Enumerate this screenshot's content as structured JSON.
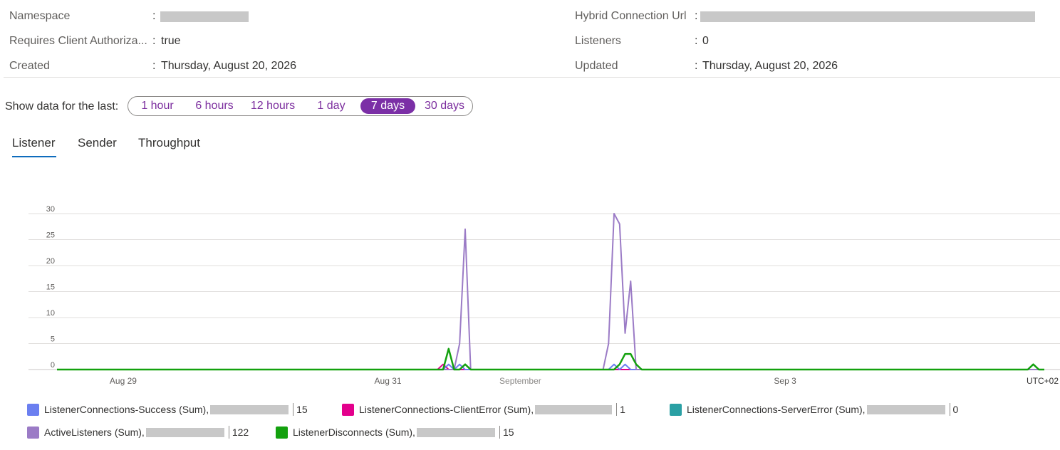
{
  "properties": {
    "left": [
      {
        "label": "Namespace",
        "value": ""
      },
      {
        "label": "Requires Client Authoriza...",
        "value": "true"
      },
      {
        "label": "Created",
        "value": "Thursday, August 20, 2026"
      }
    ],
    "right": [
      {
        "label": "Hybrid Connection Url",
        "value": ""
      },
      {
        "label": "Listeners",
        "value": "0"
      },
      {
        "label": "Updated",
        "value": "Thursday, August 20, 2026"
      }
    ],
    "colon": ":"
  },
  "range": {
    "label": "Show data for the last:",
    "options": [
      "1 hour",
      "6 hours",
      "12 hours",
      "1 day",
      "7 days",
      "30 days"
    ],
    "selected": "7 days"
  },
  "tabs": [
    {
      "label": "Listener",
      "active": true
    },
    {
      "label": "Sender",
      "active": false
    },
    {
      "label": "Throughput",
      "active": false
    }
  ],
  "chart_data": {
    "type": "line",
    "x_ticks": [
      "Aug 29",
      "Aug 31",
      "September",
      "Sep 3"
    ],
    "timezone_label": "UTC+02",
    "ylim": [
      0,
      30
    ],
    "y_ticks": [
      0,
      5,
      10,
      15,
      20,
      25,
      30
    ],
    "grid": true,
    "x_start": "Aug 28 12:00",
    "x_end": "Sep 4 23:00",
    "series": [
      {
        "name": "ListenerConnections-Success (Sum),",
        "color": "#6b7ff0",
        "total": "15",
        "points": [
          [
            "Aug 28 12:00",
            0
          ],
          [
            "Aug 31 10:00",
            0
          ],
          [
            "Aug 31 11:00",
            1
          ],
          [
            "Aug 31 12:00",
            0
          ],
          [
            "Aug 31 13:00",
            1
          ],
          [
            "Aug 31 14:00",
            0
          ],
          [
            "Sep 1 16:00",
            0
          ],
          [
            "Sep 1 17:00",
            1
          ],
          [
            "Sep 1 18:00",
            0
          ],
          [
            "Sep 1 19:00",
            1
          ],
          [
            "Sep 1 20:00",
            0
          ],
          [
            "Sep 4 23:00",
            0
          ]
        ]
      },
      {
        "name": "ListenerConnections-ClientError (Sum),",
        "color": "#e3008c",
        "total": "1",
        "points": [
          [
            "Aug 28 12:00",
            0
          ],
          [
            "Aug 31 9:00",
            0
          ],
          [
            "Aug 31 10:00",
            1
          ],
          [
            "Aug 31 11:00",
            0
          ],
          [
            "Sep 4 23:00",
            0
          ]
        ]
      },
      {
        "name": "ListenerConnections-ServerError (Sum),",
        "color": "#2aa0a4",
        "total": "0",
        "points": [
          [
            "Aug 28 12:00",
            0
          ],
          [
            "Sep 4 23:00",
            0
          ]
        ]
      },
      {
        "name": "ActiveListeners (Sum),",
        "color": "#9b7bc6",
        "total": "122",
        "points": [
          [
            "Aug 28 12:00",
            0
          ],
          [
            "Aug 31 11:00",
            0
          ],
          [
            "Aug 31 12:00",
            0
          ],
          [
            "Aug 31 13:00",
            5
          ],
          [
            "Aug 31 14:00",
            27
          ],
          [
            "Aug 31 15:00",
            0
          ],
          [
            "Sep 1 15:00",
            0
          ],
          [
            "Sep 1 16:00",
            5
          ],
          [
            "Sep 1 17:00",
            30
          ],
          [
            "Sep 1 18:00",
            28
          ],
          [
            "Sep 1 19:00",
            7
          ],
          [
            "Sep 1 20:00",
            17
          ],
          [
            "Sep 1 21:00",
            0
          ],
          [
            "Sep 4 23:00",
            0
          ]
        ]
      },
      {
        "name": "ListenerDisconnects (Sum),",
        "color": "#13a10e",
        "total": "15",
        "points": [
          [
            "Aug 28 12:00",
            0
          ],
          [
            "Aug 31 10:00",
            0
          ],
          [
            "Aug 31 11:00",
            4
          ],
          [
            "Aug 31 12:00",
            0
          ],
          [
            "Aug 31 13:00",
            0
          ],
          [
            "Aug 31 14:00",
            1
          ],
          [
            "Aug 31 15:00",
            0
          ],
          [
            "Sep 1 17:00",
            0
          ],
          [
            "Sep 1 18:00",
            1
          ],
          [
            "Sep 1 19:00",
            3
          ],
          [
            "Sep 1 20:00",
            3
          ],
          [
            "Sep 1 21:00",
            1
          ],
          [
            "Sep 1 22:00",
            0
          ],
          [
            "Sep 4 20:00",
            0
          ],
          [
            "Sep 4 21:00",
            1
          ],
          [
            "Sep 4 22:00",
            0
          ],
          [
            "Sep 4 23:00",
            0
          ]
        ]
      }
    ]
  }
}
